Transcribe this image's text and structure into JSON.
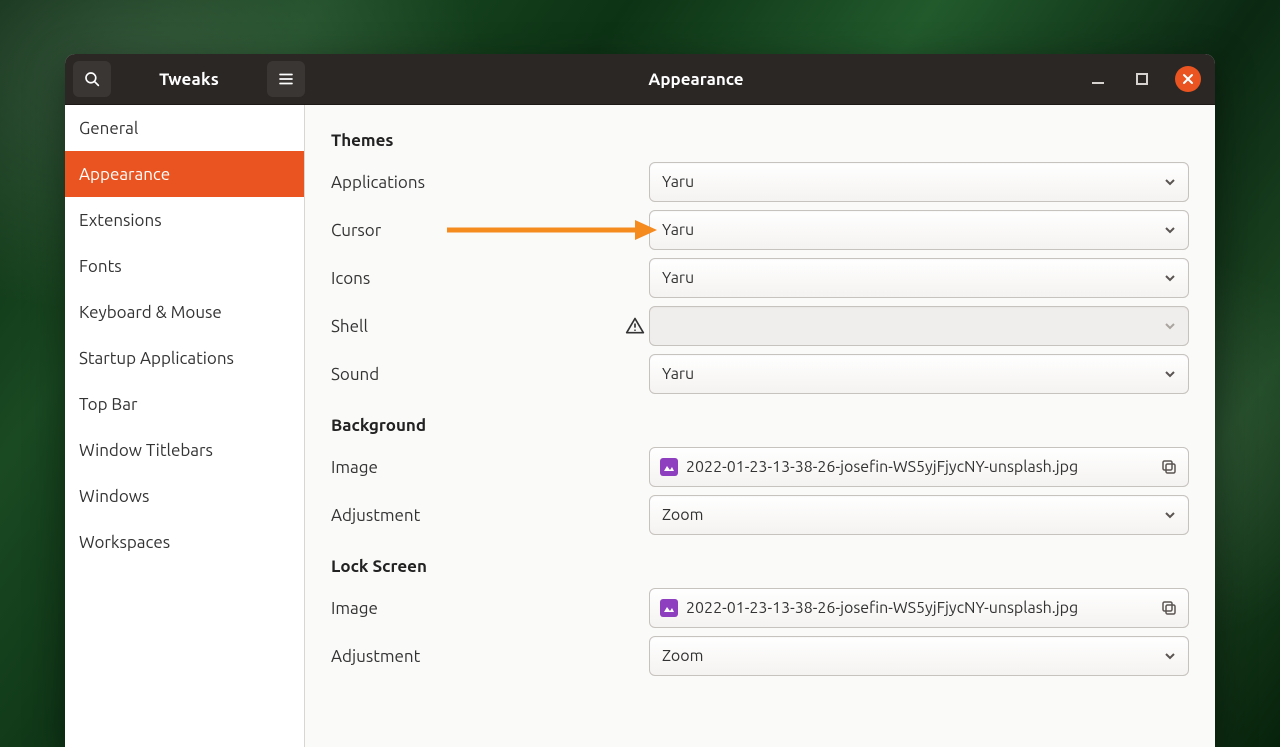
{
  "header": {
    "app_title": "Tweaks",
    "page_title": "Appearance"
  },
  "sidebar": {
    "items": [
      {
        "label": "General"
      },
      {
        "label": "Appearance"
      },
      {
        "label": "Extensions"
      },
      {
        "label": "Fonts"
      },
      {
        "label": "Keyboard & Mouse"
      },
      {
        "label": "Startup Applications"
      },
      {
        "label": "Top Bar"
      },
      {
        "label": "Window Titlebars"
      },
      {
        "label": "Windows"
      },
      {
        "label": "Workspaces"
      }
    ],
    "active_index": 1
  },
  "sections": {
    "themes": {
      "title": "Themes",
      "rows": {
        "applications": {
          "label": "Applications",
          "value": "Yaru"
        },
        "cursor": {
          "label": "Cursor",
          "value": "Yaru"
        },
        "icons": {
          "label": "Icons",
          "value": "Yaru"
        },
        "shell": {
          "label": "Shell",
          "value": ""
        },
        "sound": {
          "label": "Sound",
          "value": "Yaru"
        }
      }
    },
    "background": {
      "title": "Background",
      "image_label": "Image",
      "image_file": "2022-01-23-13-38-26-josefin-WS5yjFjycNY-unsplash.jpg",
      "adjustment_label": "Adjustment",
      "adjustment_value": "Zoom"
    },
    "lockscreen": {
      "title": "Lock Screen",
      "image_label": "Image",
      "image_file": "2022-01-23-13-38-26-josefin-WS5yjFjycNY-unsplash.jpg",
      "adjustment_label": "Adjustment",
      "adjustment_value": "Zoom"
    }
  },
  "annotation": {
    "arrow_color": "#f58a1f"
  }
}
